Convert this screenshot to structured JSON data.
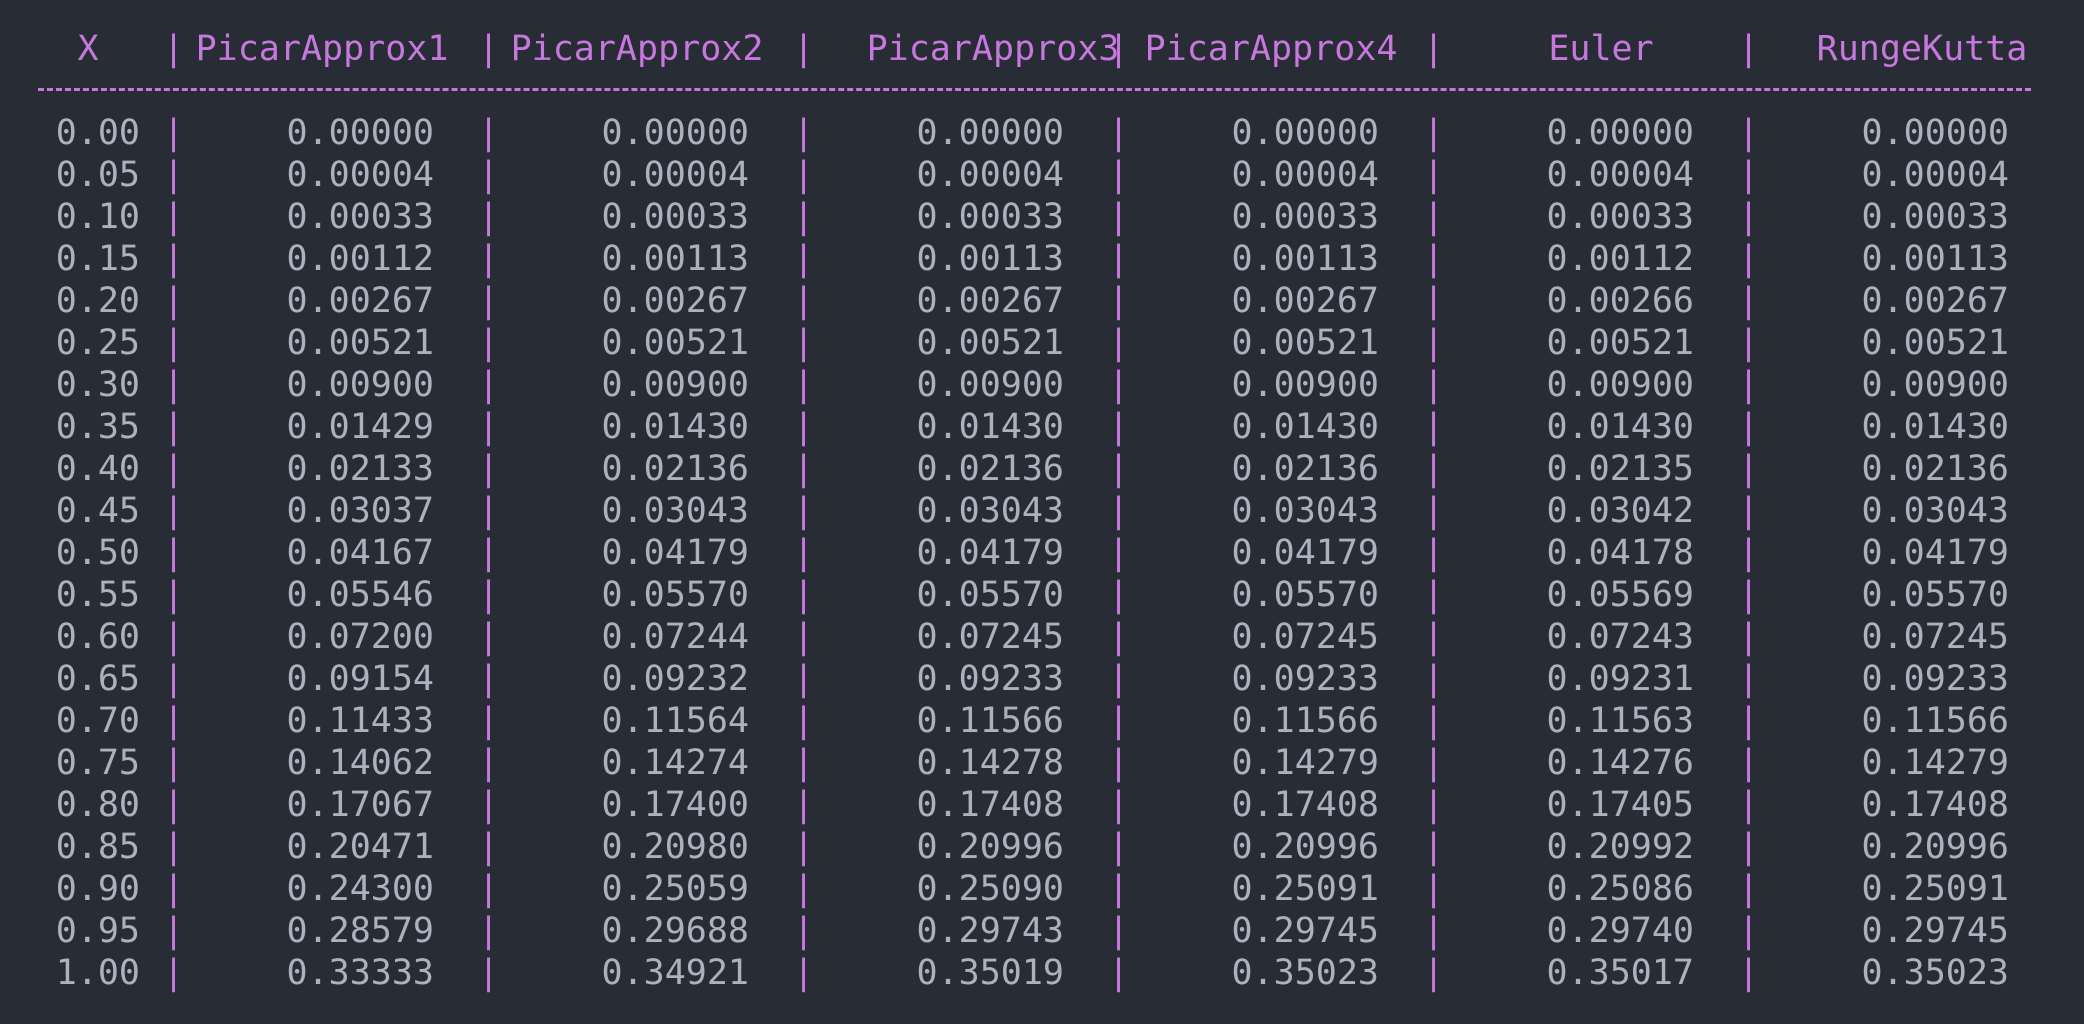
{
  "table": {
    "headers": [
      "X",
      "PicarApprox1",
      "PicarApprox2",
      "PicarApprox3",
      "PicarApprox4",
      "Euler",
      "RungeKutta"
    ],
    "separator": "|",
    "rows": [
      [
        "0.00",
        "0.00000",
        "0.00000",
        "0.00000",
        "0.00000",
        "0.00000",
        "0.00000"
      ],
      [
        "0.05",
        "0.00004",
        "0.00004",
        "0.00004",
        "0.00004",
        "0.00004",
        "0.00004"
      ],
      [
        "0.10",
        "0.00033",
        "0.00033",
        "0.00033",
        "0.00033",
        "0.00033",
        "0.00033"
      ],
      [
        "0.15",
        "0.00112",
        "0.00113",
        "0.00113",
        "0.00113",
        "0.00112",
        "0.00113"
      ],
      [
        "0.20",
        "0.00267",
        "0.00267",
        "0.00267",
        "0.00267",
        "0.00266",
        "0.00267"
      ],
      [
        "0.25",
        "0.00521",
        "0.00521",
        "0.00521",
        "0.00521",
        "0.00521",
        "0.00521"
      ],
      [
        "0.30",
        "0.00900",
        "0.00900",
        "0.00900",
        "0.00900",
        "0.00900",
        "0.00900"
      ],
      [
        "0.35",
        "0.01429",
        "0.01430",
        "0.01430",
        "0.01430",
        "0.01430",
        "0.01430"
      ],
      [
        "0.40",
        "0.02133",
        "0.02136",
        "0.02136",
        "0.02136",
        "0.02135",
        "0.02136"
      ],
      [
        "0.45",
        "0.03037",
        "0.03043",
        "0.03043",
        "0.03043",
        "0.03042",
        "0.03043"
      ],
      [
        "0.50",
        "0.04167",
        "0.04179",
        "0.04179",
        "0.04179",
        "0.04178",
        "0.04179"
      ],
      [
        "0.55",
        "0.05546",
        "0.05570",
        "0.05570",
        "0.05570",
        "0.05569",
        "0.05570"
      ],
      [
        "0.60",
        "0.07200",
        "0.07244",
        "0.07245",
        "0.07245",
        "0.07243",
        "0.07245"
      ],
      [
        "0.65",
        "0.09154",
        "0.09232",
        "0.09233",
        "0.09233",
        "0.09231",
        "0.09233"
      ],
      [
        "0.70",
        "0.11433",
        "0.11564",
        "0.11566",
        "0.11566",
        "0.11563",
        "0.11566"
      ],
      [
        "0.75",
        "0.14062",
        "0.14274",
        "0.14278",
        "0.14279",
        "0.14276",
        "0.14279"
      ],
      [
        "0.80",
        "0.17067",
        "0.17400",
        "0.17408",
        "0.17408",
        "0.17405",
        "0.17408"
      ],
      [
        "0.85",
        "0.20471",
        "0.20980",
        "0.20996",
        "0.20996",
        "0.20992",
        "0.20996"
      ],
      [
        "0.90",
        "0.24300",
        "0.25059",
        "0.25090",
        "0.25091",
        "0.25086",
        "0.25091"
      ],
      [
        "0.95",
        "0.28579",
        "0.29688",
        "0.29743",
        "0.29745",
        "0.29740",
        "0.29745"
      ],
      [
        "1.00",
        "0.33333",
        "0.34921",
        "0.35019",
        "0.35023",
        "0.35017",
        "0.35023"
      ]
    ]
  },
  "colors": {
    "background": "#282c34",
    "accent": "#c678dd",
    "text": "#abb2bf"
  }
}
